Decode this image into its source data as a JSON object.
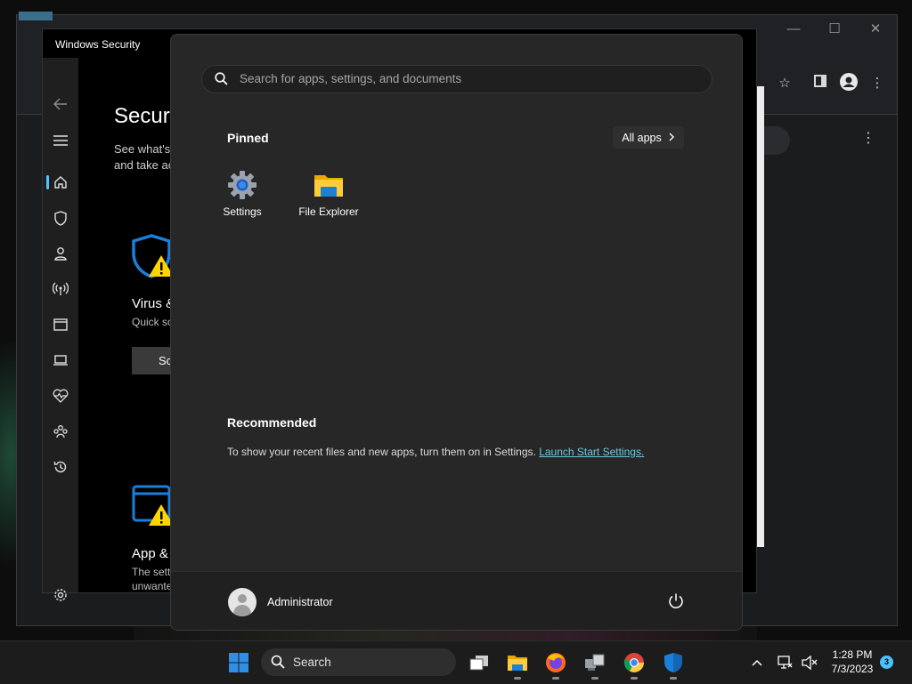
{
  "windows_security": {
    "title": "Windows Security",
    "heading": "Security at a glance",
    "intro_line1": "See what's",
    "intro_line2": "and take ac",
    "virus_title": "Virus &",
    "virus_sub": "Quick sc",
    "scan_button": "Sc",
    "app_title": "App &",
    "app_sub1": "The sett",
    "app_sub2": "unwante"
  },
  "start_menu": {
    "search_placeholder": "Search for apps, settings, and documents",
    "pinned_label": "Pinned",
    "all_apps_label": "All apps",
    "pinned_apps": [
      {
        "label": "Settings",
        "icon": "gear-icon"
      },
      {
        "label": "File Explorer",
        "icon": "folder-icon"
      }
    ],
    "recommended_label": "Recommended",
    "recommended_text": "To show your recent files and new apps, turn them on in Settings.",
    "recommended_link": "Launch Start Settings.",
    "user_name": "Administrator"
  },
  "taskbar": {
    "search_label": "Search",
    "time": "1:28 PM",
    "date": "7/3/2023",
    "notification_count": "3"
  },
  "colors": {
    "accent": "#4cc2ff",
    "start_bg": "#272727",
    "link": "#6cc7e0",
    "warning": "#ffd400",
    "shield_blue": "#1a7fdb"
  }
}
